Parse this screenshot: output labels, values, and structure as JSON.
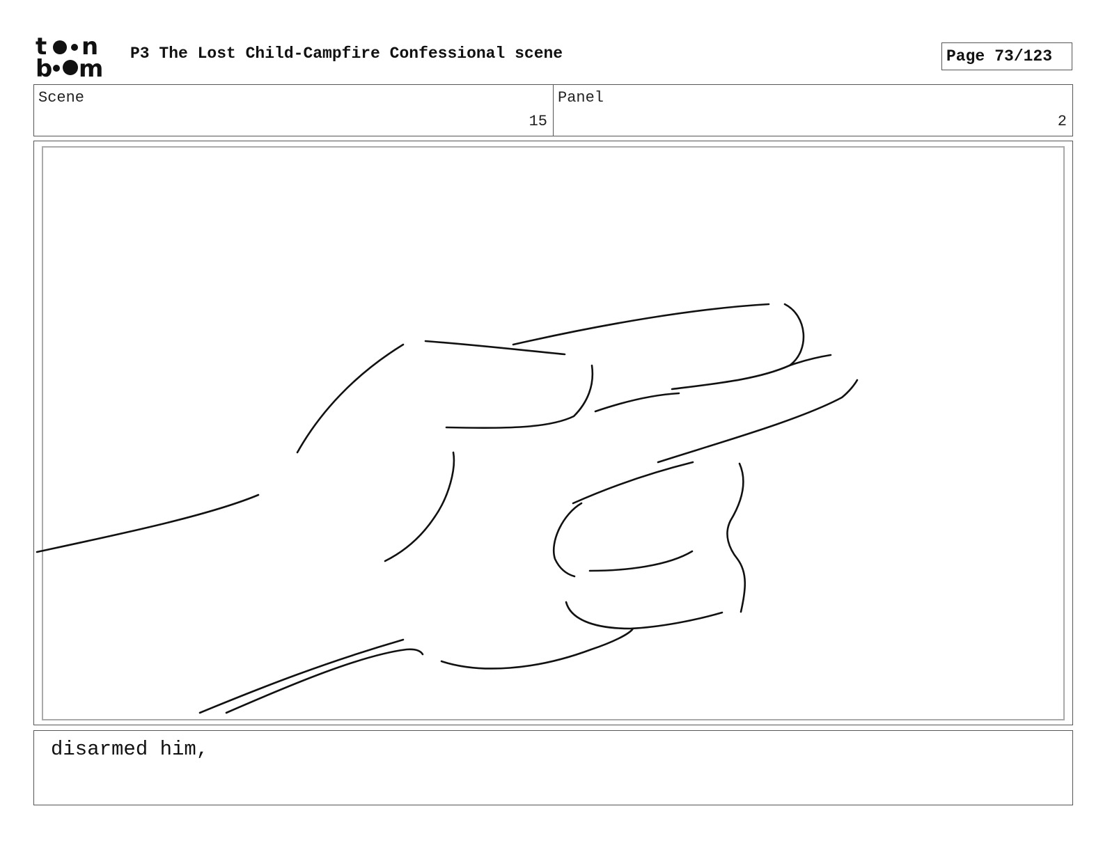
{
  "header": {
    "logo_text_top": "toon",
    "logo_text_bottom": "boom",
    "project_title": "P3 The Lost Child-Campfire Confessional scene",
    "page_label": "Page",
    "page_number": "73/123"
  },
  "info": {
    "scene_label": "Scene",
    "scene_value": "15",
    "panel_label": "Panel",
    "panel_value": "2"
  },
  "panel": {
    "drawing_subject": "hand-sketch"
  },
  "caption": {
    "text": "disarmed him,"
  },
  "colors": {
    "line": "#111111",
    "frame_border": "#555555",
    "inner_border": "#aaaaaa"
  }
}
